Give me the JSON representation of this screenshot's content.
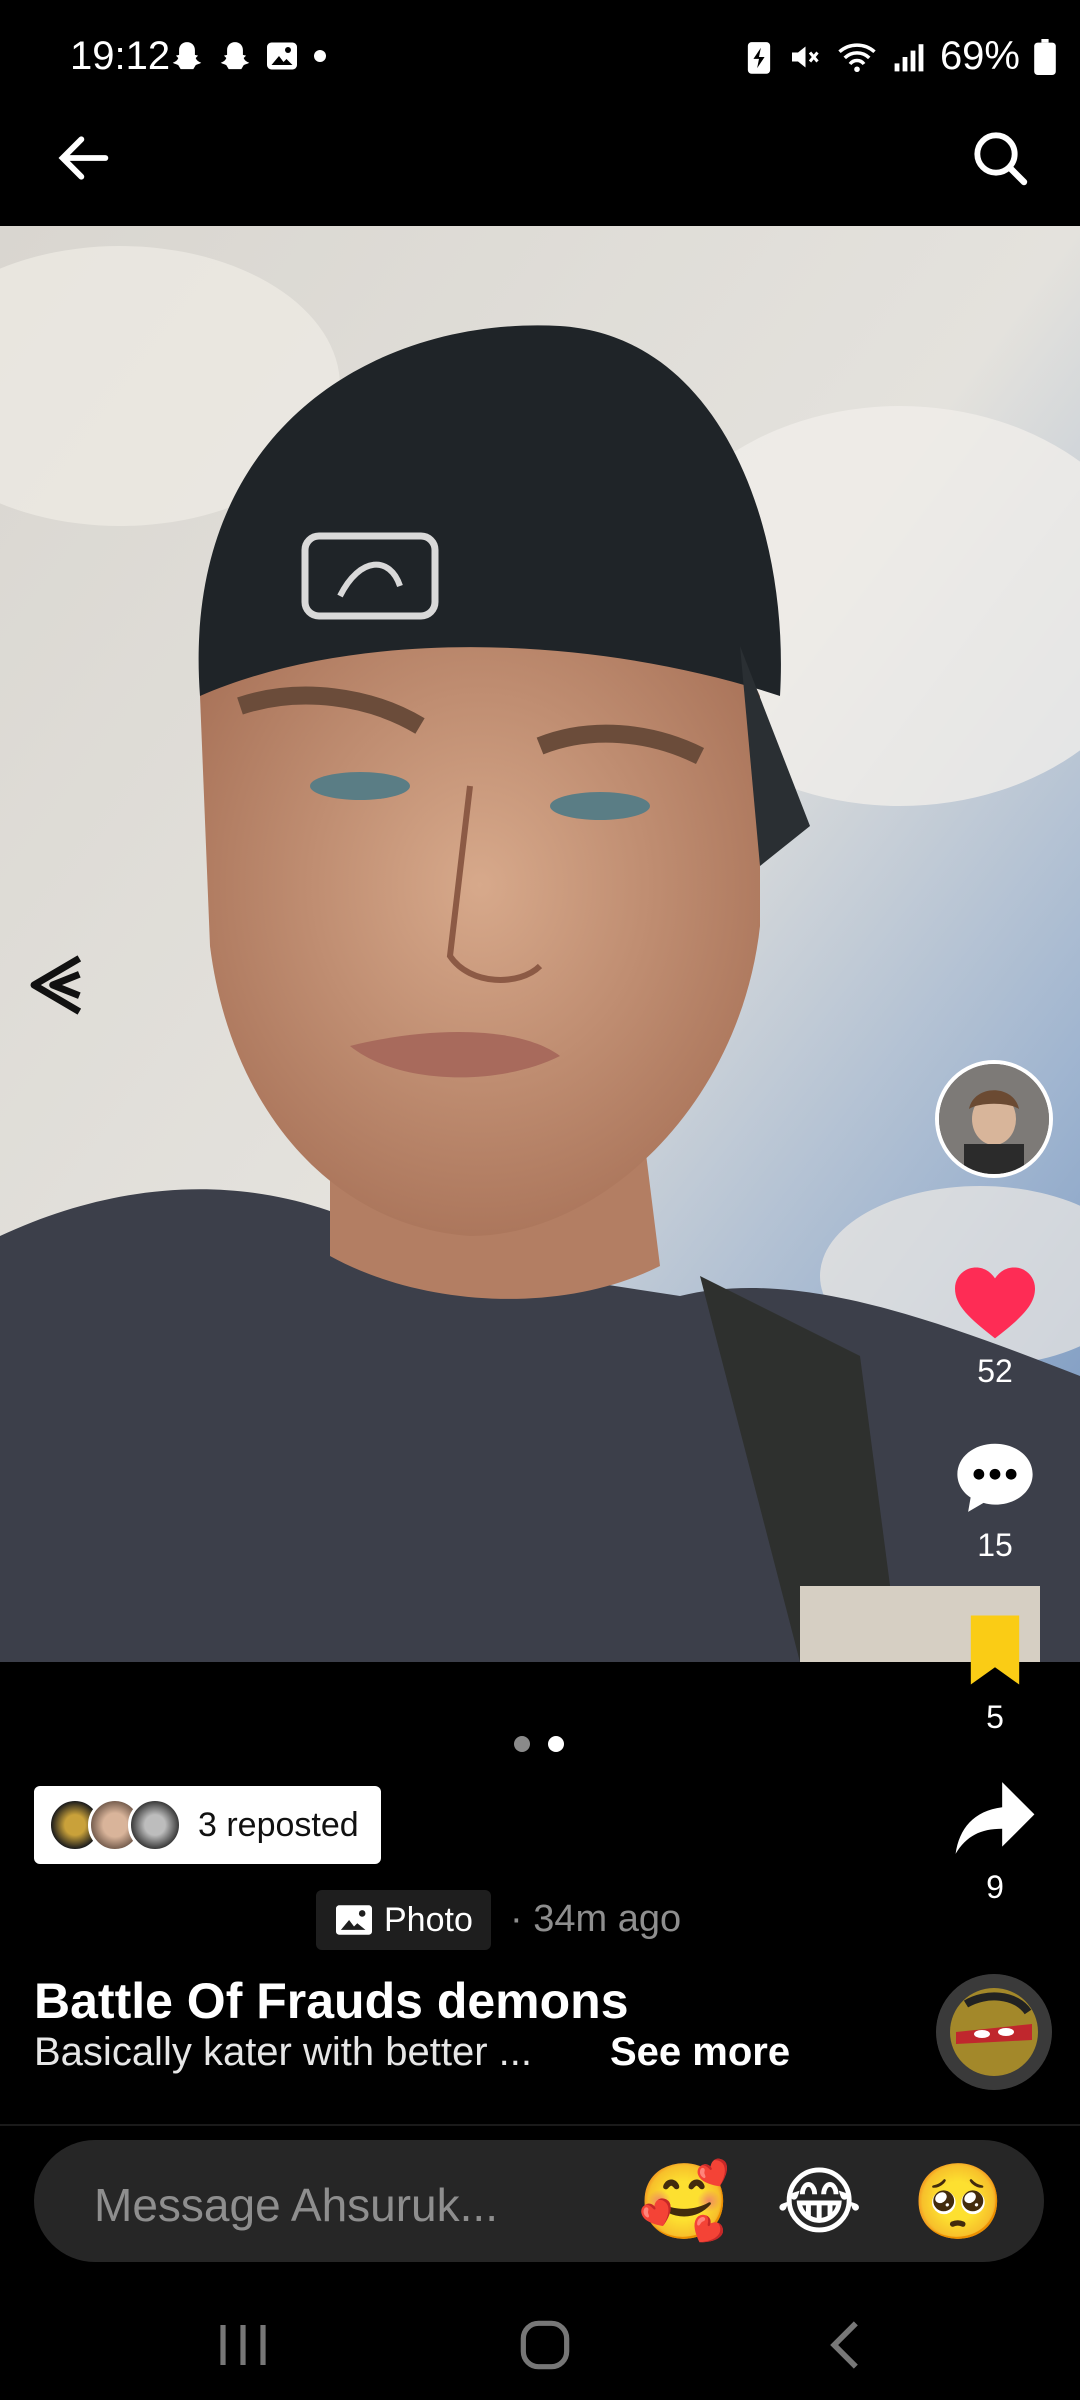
{
  "status_bar": {
    "time": "19:12",
    "left_icons": [
      "snapchat-icon",
      "snapchat-icon",
      "gallery-icon",
      "dot-icon"
    ],
    "right_icons": [
      "battery-saver-icon",
      "mute-icon",
      "wifi-icon",
      "signal-icon"
    ],
    "battery": "69%"
  },
  "top_bar": {
    "back_icon": "back-arrow-icon",
    "search_icon": "search-icon"
  },
  "post": {
    "likes": "52",
    "comments": "15",
    "saves": "5",
    "shares": "9",
    "repost_text": "3 reposted",
    "type_label": "Photo",
    "time_ago": "· 34m ago",
    "title": "Battle Of Frauds demons",
    "description": "Basically kater with better ...",
    "see_more": "See more",
    "page_count": 2,
    "active_page": 2
  },
  "message_bar": {
    "placeholder": "Message Ahsuruk...",
    "emojis": [
      "🥰",
      "😂",
      "🥺"
    ]
  },
  "colors": {
    "like": "#fe2c55",
    "save": "#facc15",
    "background": "#000000"
  }
}
